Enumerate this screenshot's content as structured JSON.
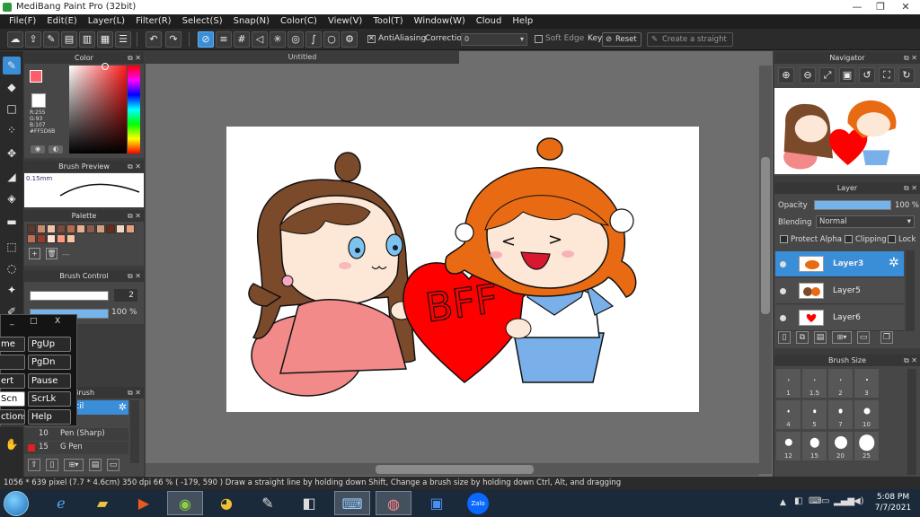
{
  "window": {
    "title": "MediBang Paint Pro (32bit)"
  },
  "menu": [
    "File(F)",
    "Edit(E)",
    "Layer(L)",
    "Filter(R)",
    "Select(S)",
    "Snap(N)",
    "Color(C)",
    "View(V)",
    "Tool(T)",
    "Window(W)",
    "Cloud",
    "Help"
  ],
  "toolbar": {
    "antialiasing": "AntiAliasing",
    "correction_label": "Correction",
    "correction_value": "0",
    "soft_edge": "Soft Edge",
    "key_label": "Key",
    "reset": "Reset",
    "create_straight": "Create a straight"
  },
  "color_panel": {
    "title": "Color",
    "r": "R:255",
    "g": "G:93",
    "b": "B:107",
    "hex": "#FF5D6B",
    "primary_color": "#ff5d6b"
  },
  "brush_preview": {
    "title": "Brush Preview",
    "size": "0.15mm"
  },
  "palette": {
    "title": "Palette",
    "colors": [
      "#5a3a2a",
      "#c98a6a",
      "#f1c4a8",
      "#7a4a3a",
      "#b56a4a",
      "#e8b090",
      "#8a5a4a",
      "#d0a080",
      "#6a2a1a",
      "#f4d8c4",
      "#e6a080",
      "#c07050",
      "#9a3a2a",
      "#fde4d4",
      "#ff9a7a",
      "#f6c6a6"
    ],
    "more": "---"
  },
  "brush_control": {
    "title": "Brush Control",
    "size": "2",
    "opacity": "100 %"
  },
  "brush_list": {
    "title": "Brush",
    "items": [
      {
        "num": "",
        "name": "Pencil"
      },
      {
        "num": "10",
        "name": "Pen (Sharp)"
      },
      {
        "num": "15",
        "name": "G Pen"
      }
    ]
  },
  "osk": {
    "keys": [
      "me",
      "PgUp",
      "PgDn",
      "ert",
      "Pause",
      "Scn",
      "ScrLk",
      "ctions",
      "Help"
    ],
    "minimize": "_",
    "restore": "□",
    "close": "X"
  },
  "canvas": {
    "tab": "Untitled",
    "title": "BFF"
  },
  "navigator": {
    "title": "Navigator"
  },
  "layer_panel": {
    "title": "Layer",
    "opacity_label": "Opacity",
    "opacity_value": "100 %",
    "opacity_fraction": 1.0,
    "blending_label": "Blending",
    "blending_value": "Normal",
    "protect_alpha": "Protect Alpha",
    "clipping": "Clipping",
    "lock": "Lock",
    "layers": [
      "Layer3",
      "Layer5",
      "Layer6"
    ]
  },
  "brush_size": {
    "title": "Brush Size",
    "labels": [
      "1",
      "1.5",
      "2",
      "3",
      "4",
      "5",
      "7",
      "10",
      "12",
      "15",
      "20",
      "25"
    ]
  },
  "status": {
    "text": "1056 * 639 pixel   (7.7 * 4.6cm)   350 dpi   66 %   ( -179, 590 )   Draw a straight line by holding down Shift, Change a brush size by holding down Ctrl, Alt, and dragging"
  },
  "taskbar": {
    "time": "5:08 PM",
    "date": "7/7/2021",
    "zalo": "Zalo"
  }
}
